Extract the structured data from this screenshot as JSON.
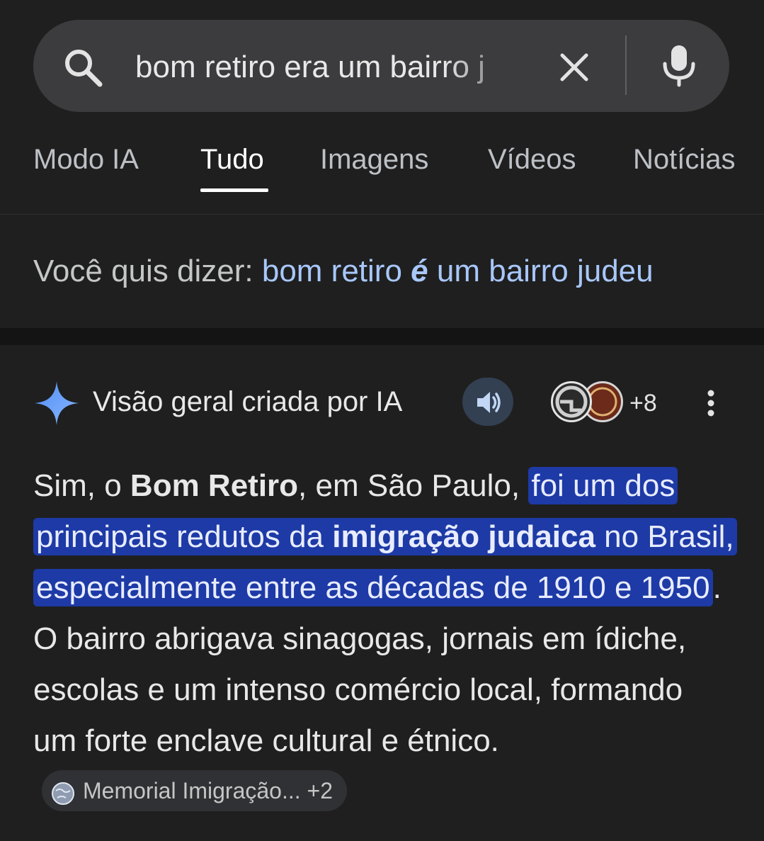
{
  "search": {
    "query": "bom retiro era um bairro j"
  },
  "tabs": [
    {
      "label": "Modo IA"
    },
    {
      "label": "Tudo"
    },
    {
      "label": "Imagens"
    },
    {
      "label": "Vídeos"
    },
    {
      "label": "Notícias"
    }
  ],
  "did_you_mean": {
    "prefix": "Você quis dizer:",
    "suggestion_part1": "bom retiro",
    "suggestion_bold": "é",
    "suggestion_part2": "um bairro judeu"
  },
  "ai_overview": {
    "title": "Visão geral criada por IA",
    "more_sources": "+8",
    "answer": {
      "p1": "Sim, o ",
      "bold1": "Bom Retiro",
      "p2": ", em São Paulo, ",
      "hl1": "foi um dos principais redutos da ",
      "hl_bold": "imigração judaica",
      "hl2": " no Brasil, especialmente entre as décadas de 1910 e 1950",
      "p3": ". O bairro abrigava sinagogas, jornais em ídiche, escolas e um intenso comércio local, formando um forte enclave cultural e étnico."
    },
    "source_chip": "Memorial Imigração... +2"
  },
  "colors": {
    "background": "#1f1f1f",
    "link": "#a8c7fa",
    "highlight": "#1d3aa6"
  }
}
